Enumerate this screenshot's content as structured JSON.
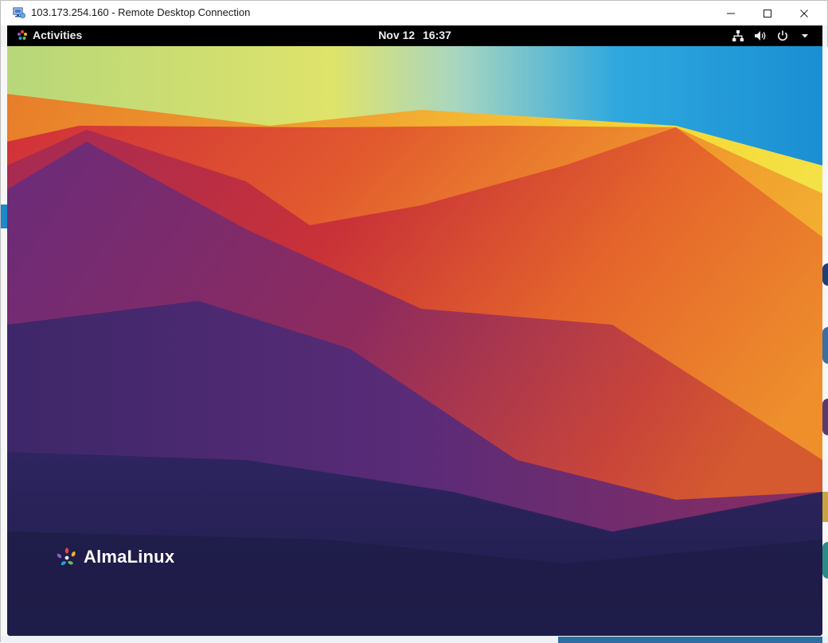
{
  "window": {
    "title": "103.173.254.160 - Remote Desktop Connection",
    "controls": {
      "minimize_icon": "minimize-icon",
      "maximize_icon": "maximize-icon",
      "close_icon": "close-icon"
    }
  },
  "topbar": {
    "activities_label": "Activities",
    "date": "Nov 12",
    "time": "16:37",
    "tray_icons": [
      "network-wired-icon",
      "volume-icon",
      "power-icon",
      "chevron-down-icon"
    ]
  },
  "desktop": {
    "brand_name": "AlmaLinux",
    "brand_icon": "almalinux-logo-icon"
  },
  "colors": {
    "topbar_bg": "#000000",
    "wallpaper_yellow": "#f6d23a",
    "wallpaper_orange": "#ec8a2c",
    "wallpaper_red": "#d63233",
    "wallpaper_purple": "#5a2a78",
    "wallpaper_navy": "#1e1d4a",
    "wallpaper_blue": "#1a8fd3"
  }
}
